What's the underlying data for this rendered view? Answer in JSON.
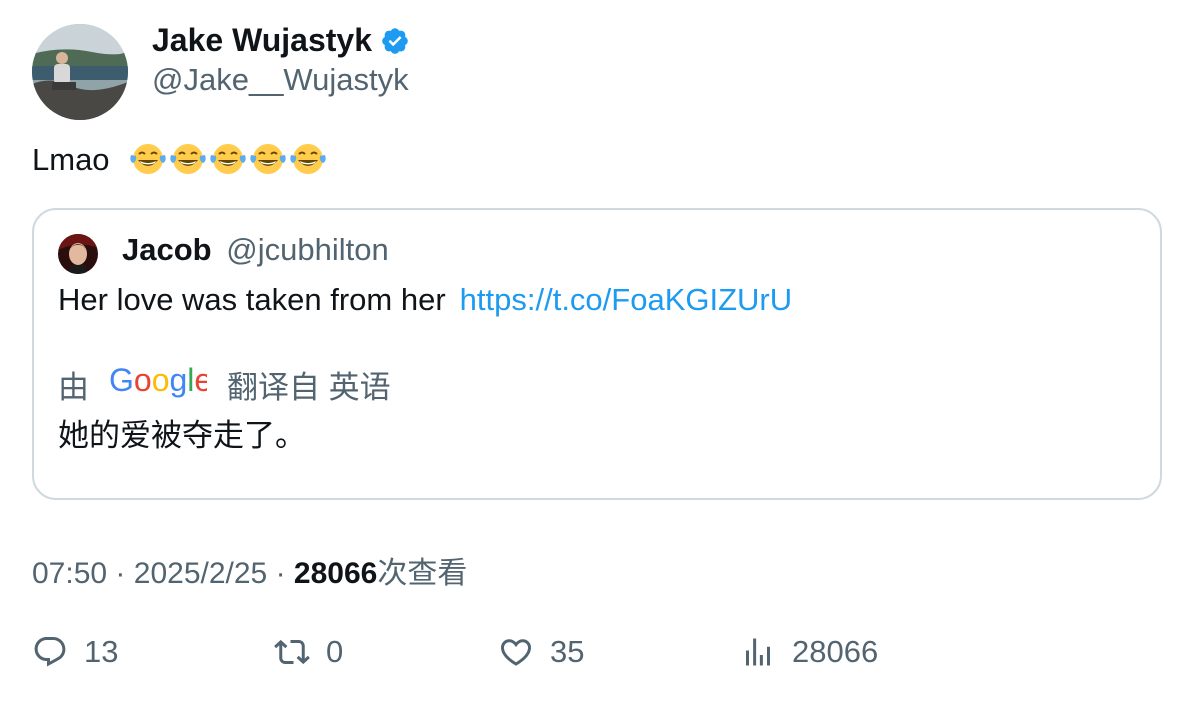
{
  "author": {
    "display_name": "Jake Wujastyk",
    "handle": "@Jake__Wujastyk",
    "verified": true
  },
  "tweet": {
    "text": "Lmao",
    "emojis": [
      "face-with-tears-of-joy",
      "face-with-tears-of-joy",
      "face-with-tears-of-joy",
      "face-with-tears-of-joy",
      "face-with-tears-of-joy"
    ]
  },
  "quoted": {
    "name": "Jacob",
    "handle": "@jcubhilton",
    "text": "Her love was taken from her",
    "link": "https://t.co/FoaKGIZUrU",
    "translation_prefix": "由",
    "translation_brand": "Google",
    "translation_suffix": "翻译自 英语",
    "translated_text": "她的爱被夺走了。"
  },
  "meta": {
    "time": "07:50",
    "sep1": "·",
    "date": "2025/2/25",
    "sep2": "·",
    "views_count": "28066",
    "views_label": "次查看"
  },
  "actions": {
    "replies": "13",
    "retweets": "0",
    "likes": "35",
    "views": "28066"
  },
  "colors": {
    "accent": "#1d9bf0",
    "secondary_text": "#536471",
    "border": "#cfd9de"
  }
}
